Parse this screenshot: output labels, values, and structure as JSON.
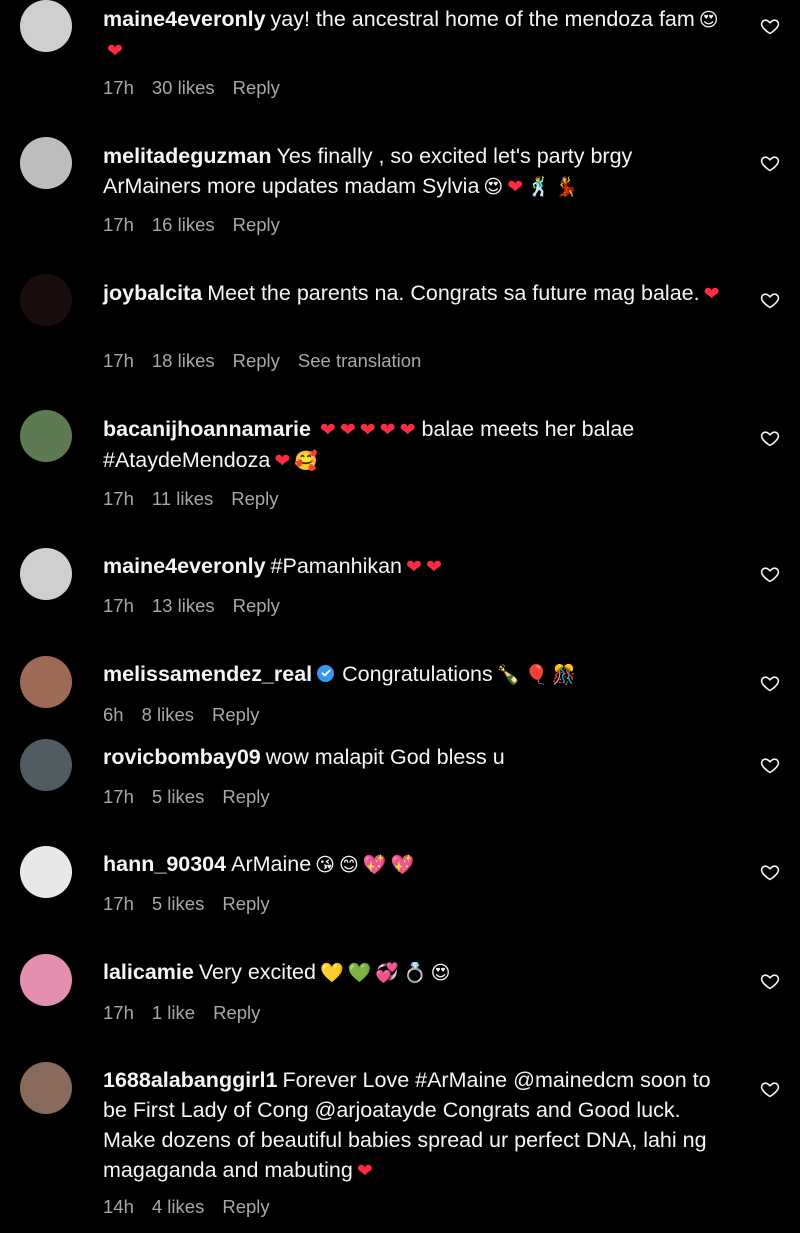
{
  "colors": {
    "background": "#000000",
    "text": "#f5f5f5",
    "muted": "#a8a8a8",
    "heart": "#ff2a44",
    "verified": "#3897f0"
  },
  "comments": [
    {
      "username": "maine4everonly",
      "text": "yay! the ancestral home of the mendoza fam",
      "emojis": [
        "😍",
        "❤"
      ],
      "time": "17h",
      "likes": "30 likes",
      "reply": "Reply",
      "avatar_color": "#cfcfcf"
    },
    {
      "username": "melitadeguzman",
      "text": "Yes finally , so excited let's party brgy ArMainers more updates madam Sylvia",
      "emojis": [
        "😍",
        "❤",
        "🕺",
        "💃"
      ],
      "time": "17h",
      "likes": "16 likes",
      "reply": "Reply",
      "avatar_color": "#bdbdbd"
    },
    {
      "username": "joybalcita",
      "text": "Meet the parents na. Congrats sa future mag balae.",
      "emojis": [
        "❤"
      ],
      "time": "17h",
      "likes": "18 likes",
      "reply": "Reply",
      "see_translation": "See translation",
      "avatar_color": "#1a0d0d"
    },
    {
      "username": "bacanijhoannamarie",
      "emojis_lead": [
        "❤",
        "❤",
        "❤",
        "❤",
        "❤"
      ],
      "text": "balae meets her balae #AtaydeMendoza",
      "emojis": [
        "❤",
        "🥰"
      ],
      "time": "17h",
      "likes": "11 likes",
      "reply": "Reply",
      "avatar_color": "#5e7a52"
    },
    {
      "username": "maine4everonly",
      "text": "#Pamanhikan",
      "emojis": [
        "❤",
        "❤"
      ],
      "time": "17h",
      "likes": "13 likes",
      "reply": "Reply",
      "avatar_color": "#cfcfcf"
    },
    {
      "username": "melissamendez_real",
      "verified": true,
      "text": "Congratulations",
      "emojis": [
        "🍾",
        "🎈",
        "🎊"
      ],
      "time": "6h",
      "likes": "8 likes",
      "reply": "Reply",
      "avatar_color": "#9c6a55"
    },
    {
      "username": "rovicbombay09",
      "text": "wow malapit God bless u",
      "emojis": [],
      "time": "17h",
      "likes": "5 likes",
      "reply": "Reply",
      "avatar_color": "#4f5d62"
    },
    {
      "username": "hann_90304",
      "text": "ArMaine",
      "emojis": [
        "😘",
        "😊",
        "💖",
        "💖"
      ],
      "time": "17h",
      "likes": "5 likes",
      "reply": "Reply",
      "avatar_color": "#e8e8e8"
    },
    {
      "username": "lalicamie",
      "text": "Very excited",
      "emojis": [
        "💛",
        "💚",
        "💞",
        "💍",
        "😍"
      ],
      "time": "17h",
      "likes": "1 like",
      "reply": "Reply",
      "avatar_color": "#e58fb0"
    },
    {
      "username": "1688alabanggirl1",
      "text": "Forever Love #ArMaine @mainedcm soon to be First Lady of Cong @arjoatayde Congrats and Good luck. Make dozens of beautiful babies spread ur perfect DNA, lahi ng magaganda and mabuting",
      "emojis": [
        "❤"
      ],
      "time": "14h",
      "likes": "4 likes",
      "reply": "Reply",
      "avatar_color": "#8a6a5a"
    }
  ]
}
